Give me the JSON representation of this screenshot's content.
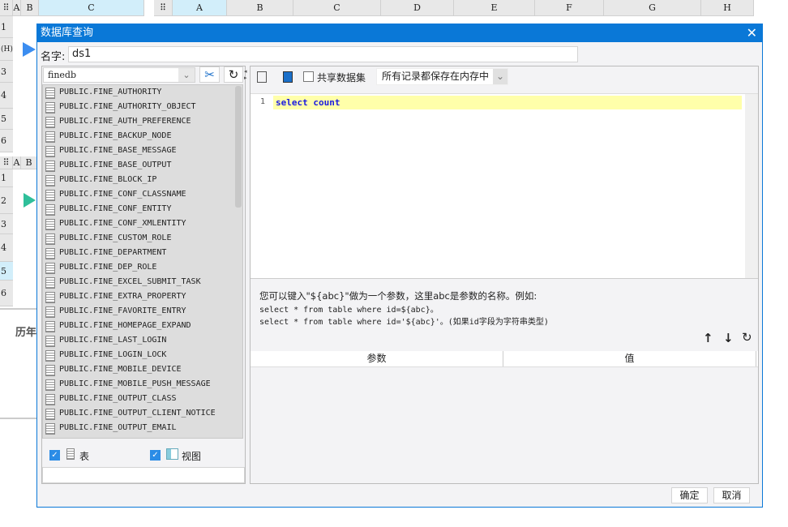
{
  "sheet1": {
    "columns": [
      "A",
      "B",
      "C"
    ],
    "rows": [
      "1",
      "(H)",
      "3",
      "4",
      "5",
      "6"
    ]
  },
  "sheet2": {
    "columns": [
      "A",
      "B",
      "C",
      "D",
      "E",
      "F",
      "G",
      "H"
    ]
  },
  "sheet3": {
    "columns": [
      "A",
      "B"
    ],
    "rows": [
      "1",
      "2",
      "3",
      "4",
      "5",
      "6"
    ]
  },
  "bg_text": "历年",
  "dialog": {
    "title": "数据库查询",
    "name_label": "名字:",
    "name_value": "ds1",
    "connection": "finedb",
    "tables": [
      "PUBLIC.FINE_AUTHORITY",
      "PUBLIC.FINE_AUTHORITY_OBJECT",
      "PUBLIC.FINE_AUTH_PREFERENCE",
      "PUBLIC.FINE_BACKUP_NODE",
      "PUBLIC.FINE_BASE_MESSAGE",
      "PUBLIC.FINE_BASE_OUTPUT",
      "PUBLIC.FINE_BLOCK_IP",
      "PUBLIC.FINE_CONF_CLASSNAME",
      "PUBLIC.FINE_CONF_ENTITY",
      "PUBLIC.FINE_CONF_XMLENTITY",
      "PUBLIC.FINE_CUSTOM_ROLE",
      "PUBLIC.FINE_DEPARTMENT",
      "PUBLIC.FINE_DEP_ROLE",
      "PUBLIC.FINE_EXCEL_SUBMIT_TASK",
      "PUBLIC.FINE_EXTRA_PROPERTY",
      "PUBLIC.FINE_FAVORITE_ENTRY",
      "PUBLIC.FINE_HOMEPAGE_EXPAND",
      "PUBLIC.FINE_LAST_LOGIN",
      "PUBLIC.FINE_LOGIN_LOCK",
      "PUBLIC.FINE_MOBILE_DEVICE",
      "PUBLIC.FINE_MOBILE_PUSH_MESSAGE",
      "PUBLIC.FINE_OUTPUT_CLASS",
      "PUBLIC.FINE_OUTPUT_CLIENT_NOTICE",
      "PUBLIC.FINE_OUTPUT_EMAIL"
    ],
    "filter_table": {
      "label": "表",
      "checked": true
    },
    "filter_view": {
      "label": "视图",
      "checked": true
    },
    "share_dataset": {
      "label": "共享数据集",
      "checked": false
    },
    "storage_mode": "所有记录都保存在内存中",
    "sql_line_number": "1",
    "sql": "select count",
    "hint": [
      "您可以键入\"${abc}\"做为一个参数，这里abc是参数的名称。例如:",
      "select * from table where id=${abc}。",
      "select * from table where id='${abc}'。(如果id字段为字符串类型)"
    ],
    "param_columns": [
      "参数",
      "值"
    ],
    "ok": "确定",
    "cancel": "取消",
    "accent": "#0a78d7"
  }
}
